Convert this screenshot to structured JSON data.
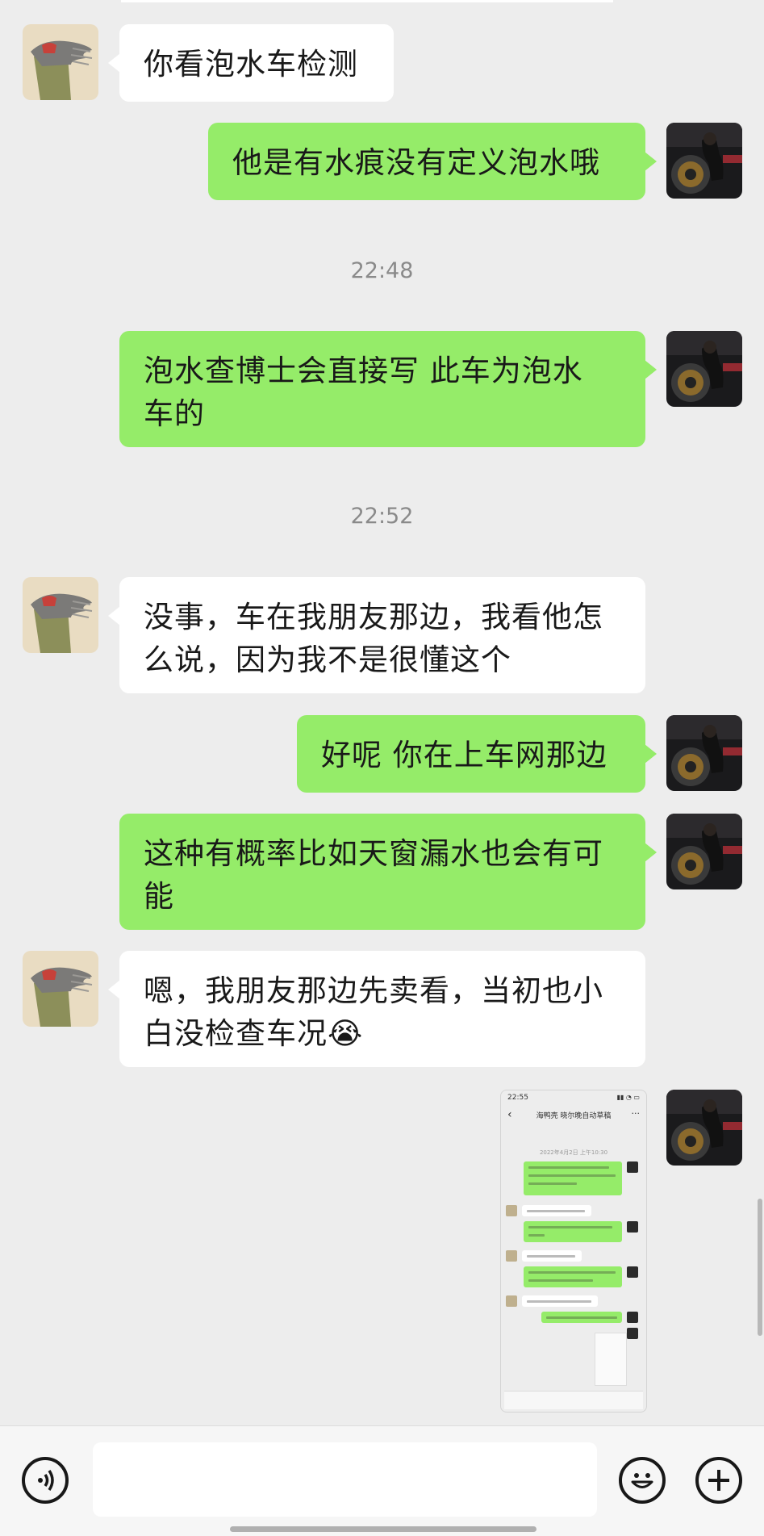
{
  "messages": [
    {
      "side": "left",
      "text": "你看泡水车检测"
    },
    {
      "side": "right",
      "text": "他是有水痕没有定义泡水哦"
    },
    {
      "time": "22:48"
    },
    {
      "side": "right",
      "text": "泡水查博士会直接写 此车为泡水车的"
    },
    {
      "time": "22:52"
    },
    {
      "side": "left",
      "text": "没事，车在我朋友那边，我看他怎么说，因为我不是很懂这个"
    },
    {
      "side": "right",
      "text": "好呢 你在上车网那边"
    },
    {
      "side": "right",
      "text": "这种有概率比如天窗漏水也会有可能"
    },
    {
      "side": "left",
      "text": "嗯，我朋友那边先卖看，当初也小白没检查车况",
      "emoji": "😭"
    },
    {
      "side": "right",
      "type": "image",
      "text": "screenshot"
    }
  ],
  "m": {
    "m1": "你看泡水车检测",
    "m2": "他是有水痕没有定义泡水哦",
    "t1": "22:48",
    "m3a": "泡水查博士会直接写 此车为泡水",
    "m3b": "车的",
    "t2": "22:52",
    "m4a": "没事，车在我朋友那边，我看他怎",
    "m4b": "么说，因为我不是很懂这个",
    "m5": "好呢 你在上车网那边",
    "m6a": "这种有概率比如天窗漏水也会有可",
    "m6b": "能",
    "m7a": "嗯，我朋友那边先卖看，当初也小",
    "m7b": "白没检查车况",
    "m7emoji": "😭"
  },
  "thumbnail": {
    "status_time": "22:55",
    "title": "海鸭壳 晓尔晚自动草稿",
    "date": "2022年4月2日 上午10:30"
  },
  "input_bar": {
    "voice_icon": "voice-icon",
    "emoji_icon": "emoji-icon",
    "plus_icon": "plus-icon"
  },
  "colors": {
    "background": "#ededed",
    "bubble_self": "#95ec69",
    "bubble_other": "#ffffff",
    "timestamp": "#8a8a8a"
  }
}
